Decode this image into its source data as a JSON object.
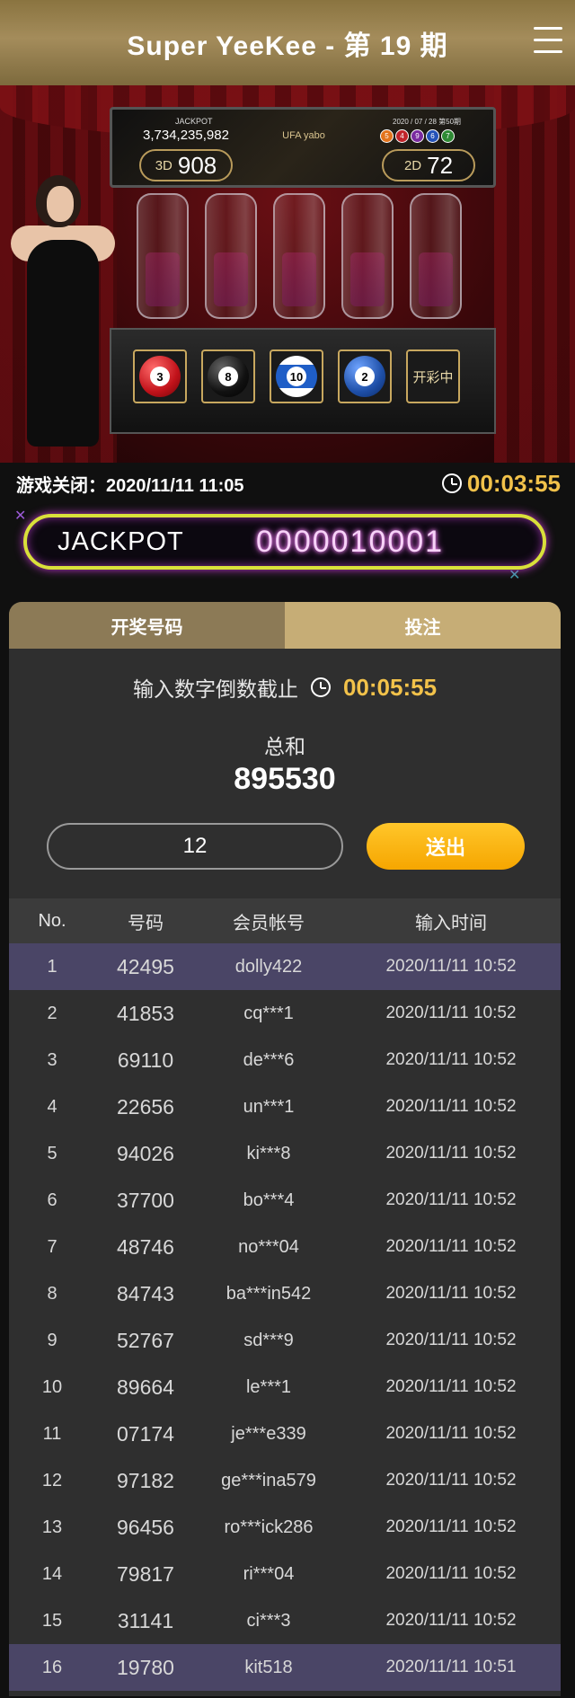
{
  "header": {
    "title": "Super YeeKee - 第 19 期"
  },
  "board": {
    "jackpot_label": "JACKPOT",
    "jackpot_value": "3,734,235,982",
    "brand": "UFA yabo",
    "draw_date": "2020 / 07 / 28 第50期",
    "mini_balls": [
      "5",
      "4",
      "9",
      "6",
      "7"
    ],
    "three_d": {
      "label": "3D",
      "value": "908"
    },
    "two_d": {
      "label": "2D",
      "value": "72"
    },
    "balls": [
      "3",
      "8",
      "10",
      "2"
    ],
    "drawing_status": "开彩中"
  },
  "info": {
    "close_time": "游戏关闭：2020/11/11 11:05",
    "countdown": "00:03:55"
  },
  "jackpot_banner": {
    "label": "JACKPOT",
    "value": "0000010001"
  },
  "tabs": [
    {
      "label": "开奖号码"
    },
    {
      "label": "投注"
    }
  ],
  "entry": {
    "countdown_label": "输入数字倒数截止",
    "countdown_value": "00:05:55",
    "sum_label": "总和",
    "sum_value": "895530",
    "input_value": "12",
    "send_label": "送出"
  },
  "table": {
    "headers": [
      "No.",
      "号码",
      "会员帐号",
      "输入时间"
    ],
    "rows": [
      [
        "1",
        "42495",
        "dolly422",
        "2020/11/11 10:52"
      ],
      [
        "2",
        "41853",
        "cq***1",
        "2020/11/11 10:52"
      ],
      [
        "3",
        "69110",
        "de***6",
        "2020/11/11 10:52"
      ],
      [
        "4",
        "22656",
        "un***1",
        "2020/11/11 10:52"
      ],
      [
        "5",
        "94026",
        "ki***8",
        "2020/11/11 10:52"
      ],
      [
        "6",
        "37700",
        "bo***4",
        "2020/11/11 10:52"
      ],
      [
        "7",
        "48746",
        "no***04",
        "2020/11/11 10:52"
      ],
      [
        "8",
        "84743",
        "ba***in542",
        "2020/11/11 10:52"
      ],
      [
        "9",
        "52767",
        "sd***9",
        "2020/11/11 10:52"
      ],
      [
        "10",
        "89664",
        "le***1",
        "2020/11/11 10:52"
      ],
      [
        "11",
        "07174",
        "je***e339",
        "2020/11/11 10:52"
      ],
      [
        "12",
        "97182",
        "ge***ina579",
        "2020/11/11 10:52"
      ],
      [
        "13",
        "96456",
        "ro***ick286",
        "2020/11/11 10:52"
      ],
      [
        "14",
        "79817",
        "ri***04",
        "2020/11/11 10:52"
      ],
      [
        "15",
        "31141",
        "ci***3",
        "2020/11/11 10:52"
      ],
      [
        "16",
        "19780",
        "kit518",
        "2020/11/11 10:51"
      ]
    ],
    "highlight_rows": [
      1,
      16
    ]
  }
}
